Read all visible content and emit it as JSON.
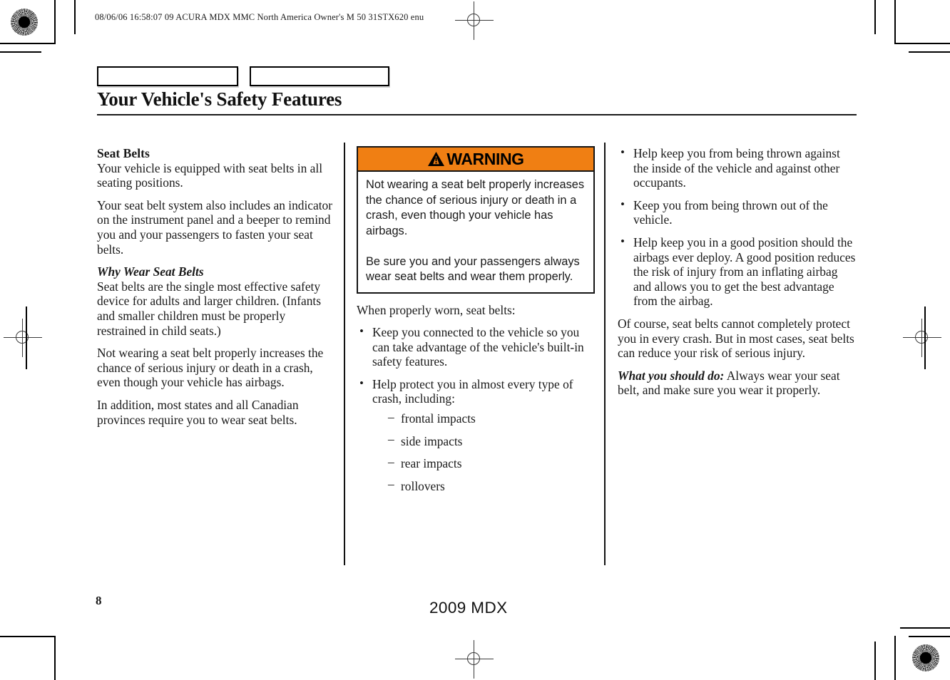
{
  "header": {
    "slug": "08/06/06 16:58:07   09 ACURA MDX MMC North America Owner's M 50 31STX620 enu"
  },
  "title": {
    "text": "Your Vehicle's Safety Features"
  },
  "tabs": [
    {
      "label": ""
    },
    {
      "label": ""
    }
  ],
  "column1": {
    "heading": "Seat Belts",
    "para1": "Your vehicle is equipped with seat belts in all seating positions.",
    "para2": "Your seat belt system also includes an indicator on the instrument panel and a beeper to remind you and your passengers to fasten your seat belts.",
    "subheading": "Why Wear Seat Belts",
    "para3": "Seat belts are the single most effective safety device for adults and larger children. (Infants and smaller children must be properly restrained in child seats.)",
    "para4": "Not wearing a seat belt properly increases the chance of serious injury or death in a crash, even though your vehicle has airbags.",
    "para5": "In addition, most states and all Canadian provinces require you to wear seat belts."
  },
  "column2": {
    "warning": {
      "label": "WARNING",
      "icon": "warning-triangle-icon",
      "header_color": "#F07F13",
      "body1": "Not wearing a seat belt properly increases the chance of serious injury or death in a crash, even though your vehicle has airbags.",
      "body2": "Be sure you and your passengers always wear seat belts and wear them properly."
    },
    "intro": "When properly worn, seat belts:",
    "bullets": [
      "Keep you connected to the vehicle so you can take advantage of the vehicle's built-in safety features.",
      "Help protect you in almost every type of crash, including:"
    ],
    "subitems": [
      "frontal impacts",
      "side impacts",
      "rear impacts",
      "rollovers"
    ]
  },
  "column3": {
    "bullets": [
      "Help keep you from being thrown against the inside of the vehicle and against other occupants.",
      "Keep you from being thrown out of the vehicle.",
      "Help keep you in a good position should the airbags ever deploy. A good position reduces the risk of injury from an inflating airbag and allows you to get the best advantage from the airbag."
    ],
    "para1": "Of course, seat belts cannot completely protect you in every crash. But in most cases, seat belts can reduce your risk of serious injury.",
    "runin_label": "What you should do:",
    "runin_text": " Always wear your seat belt, and make sure you wear it properly."
  },
  "footer": {
    "page_number": "8",
    "model": "2009  MDX"
  }
}
